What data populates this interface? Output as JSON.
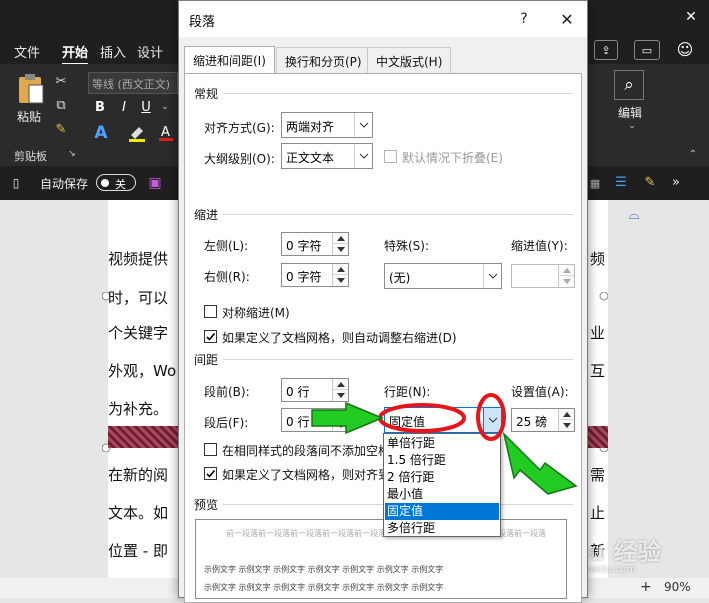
{
  "word": {
    "ribbon_tabs": [
      "文件",
      "开始",
      "插入",
      "设计"
    ],
    "active_tab": "开始",
    "font_name": "等线 (西文正文)",
    "clipboard_label": "剪贴板",
    "paste_label": "粘贴",
    "editing_label": "编辑",
    "autosave_label": "自动保存",
    "autosave_toggle": "关",
    "document_lines": [
      "视频提供",
      "时，可以",
      "个关键字",
      "外观，Wo",
      "为补充。",
      "",
      "在新的阅",
      "文本。如",
      "位置 - 即"
    ],
    "right_fragments": [
      "频",
      "业",
      "互",
      "需",
      "止",
      "新"
    ],
    "zoom": "90%",
    "watermark": "Baidu 经验",
    "watermark_url": "jingyan.baidu.com"
  },
  "dialog": {
    "title": "段落",
    "help": "?",
    "close": "✕",
    "tabs": [
      "缩进和间距(I)",
      "换行和分页(P)",
      "中文版式(H)"
    ],
    "general": {
      "section": "常规",
      "alignment_label": "对齐方式(G):",
      "alignment_value": "两端对齐",
      "outline_label": "大纲级别(O):",
      "outline_value": "正文文本",
      "collapse_label": "默认情况下折叠(E)"
    },
    "indent": {
      "section": "缩进",
      "left_label": "左侧(L):",
      "left_value": "0 字符",
      "right_label": "右侧(R):",
      "right_value": "0 字符",
      "special_label": "特殊(S):",
      "special_value": "(无)",
      "by_label": "缩进值(Y):",
      "by_value": "",
      "mirror_label": "对称缩进(M)",
      "auto_adjust_label": "如果定义了文档网格，则自动调整右缩进(D)"
    },
    "spacing": {
      "section": "间距",
      "before_label": "段前(B):",
      "before_value": "0 行",
      "after_label": "段后(F):",
      "after_value": "0 行",
      "line_label": "行距(N):",
      "line_value": "固定值",
      "at_label": "设置值(A):",
      "at_value": "25 磅",
      "no_space_label": "在相同样式的段落间不添加空格",
      "snap_label": "如果定义了文档网格，则对齐到"
    },
    "line_spacing_options": [
      "单倍行距",
      "1.5 倍行距",
      "2 倍行距",
      "最小值",
      "固定值",
      "多倍行距"
    ],
    "selected_option": "固定值",
    "preview": {
      "section": "预览",
      "prev_text": "前一段落前一段落前一段落前一段落前一段落前一段落前一段落前一段落前一段落前一段落",
      "sample_text": "示例文字 示例文字 示例文字 示例文字 示例文字 示例文字 示例文字"
    }
  },
  "colors": {
    "accent": "#0078d7",
    "annotation_red": "#e8141b",
    "annotation_green": "#22cc22"
  }
}
